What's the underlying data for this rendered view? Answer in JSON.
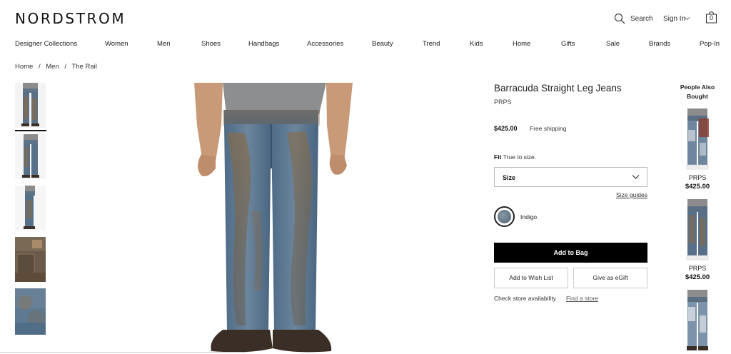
{
  "header": {
    "logo": "NORDSTROM",
    "search_label": "Search",
    "signin_label": "Sign In",
    "bag_count": "0"
  },
  "nav": {
    "items": [
      "Designer Collections",
      "Women",
      "Men",
      "Shoes",
      "Handbags",
      "Accessories",
      "Beauty",
      "Trend",
      "Kids",
      "Home",
      "Gifts",
      "Sale",
      "Brands",
      "Pop-In"
    ]
  },
  "breadcrumb": {
    "items": [
      "Home",
      "Men",
      "The Rail"
    ],
    "separator": "/"
  },
  "gallery": {
    "thumbnail_count": 5,
    "selected_index": 0
  },
  "product": {
    "title": "Barracuda Straight Leg Jeans",
    "brand": "PRPS",
    "price": "$425.00",
    "shipping": "Free shipping",
    "fit_label": "Fit",
    "fit_value": "True to size.",
    "size_placeholder": "Size",
    "size_guides": "Size guides",
    "color_name": "Indigo",
    "add_to_bag": "Add to Bag",
    "add_to_wishlist": "Add to Wish List",
    "give_egift": "Give as eGift",
    "store_text": "Check store availability",
    "find_store": "Find a store"
  },
  "also_bought": {
    "title": "People Also Bought",
    "items": [
      {
        "brand": "PRPS",
        "price": "$425.00"
      },
      {
        "brand": "PRPS",
        "price": "$425.00"
      }
    ]
  },
  "colors": {
    "accent": "#000000",
    "denim": "#4e6a82",
    "mud": "#8a6a44"
  }
}
